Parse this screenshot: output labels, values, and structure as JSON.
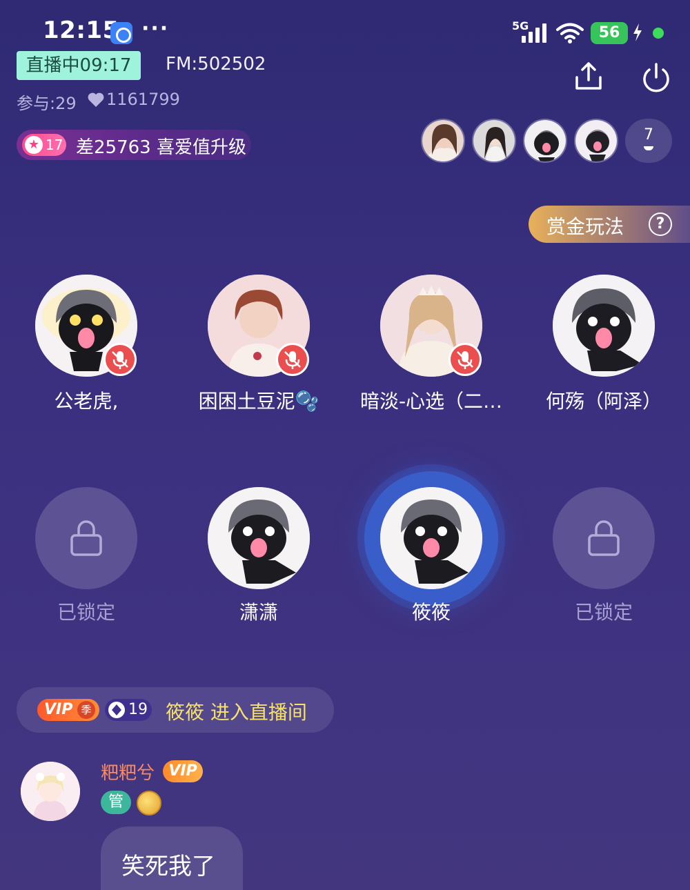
{
  "status_bar": {
    "time": "12:15",
    "more": "···",
    "network": "5G",
    "battery": "56"
  },
  "room": {
    "live_label": "直播中09:17",
    "fm_id": "FM:502502",
    "participants": "参与:29",
    "likes": "1161799",
    "level": "17",
    "level_text": "差25763 喜爱值升级",
    "viewer_count": "7",
    "bounty_label": "赏金玩法",
    "help_symbol": "?"
  },
  "seats": [
    {
      "name": "公老虎,",
      "muted": true,
      "locked": false,
      "avatar": "knight-glow"
    },
    {
      "name": "困困土豆泥🫧",
      "muted": true,
      "locked": false,
      "avatar": "man-portrait"
    },
    {
      "name": "暗淡-心选（二…",
      "muted": true,
      "locked": false,
      "avatar": "woman-portrait"
    },
    {
      "name": "何殇（阿泽）",
      "muted": false,
      "locked": false,
      "avatar": "knight-dark"
    },
    {
      "name": "已锁定",
      "muted": false,
      "locked": true
    },
    {
      "name": "潇潇",
      "muted": false,
      "locked": false,
      "avatar": "knight"
    },
    {
      "name": "筱筱",
      "muted": false,
      "locked": false,
      "avatar": "knight",
      "speaking": true
    },
    {
      "name": "已锁定",
      "muted": false,
      "locked": true
    }
  ],
  "chat": {
    "enter_event": {
      "vip_label": "VIP",
      "vip_season": "季",
      "rank": "19",
      "text": "筱筱 进入直播间"
    },
    "message": {
      "user": "粑粑兮",
      "vip_label": "VIP",
      "admin_label": "管",
      "text": "笑死我了"
    }
  },
  "colors": {
    "live_badge_bg": "#9ff2dc",
    "mute_red": "#ea4e4e",
    "enter_name": "#f6e26a",
    "chat_user": "#ff8a5a"
  }
}
